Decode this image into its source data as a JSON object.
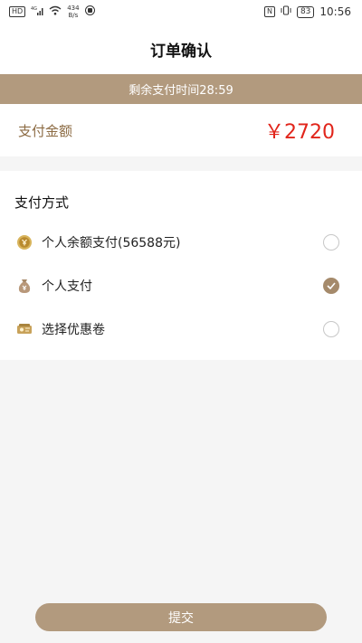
{
  "status_bar": {
    "hd_label": "HD",
    "network_label": "4G",
    "speed_value": "434",
    "speed_unit": "B/s",
    "nfc_label": "N",
    "battery": "83",
    "time": "10:56"
  },
  "header": {
    "title": "订单确认"
  },
  "countdown": {
    "text": "剩余支付时间28:59"
  },
  "amount": {
    "label": "支付金额",
    "value": "￥2720",
    "value_color": "#e1251b"
  },
  "payment": {
    "title": "支付方式",
    "methods": [
      {
        "label": "个人余额支付(56588元)",
        "icon": "coin-icon",
        "selected": false
      },
      {
        "label": "个人支付",
        "icon": "money-bag-icon",
        "selected": true
      },
      {
        "label": "选择优惠卷",
        "icon": "coupon-icon",
        "selected": false
      }
    ]
  },
  "submit": {
    "label": "提交"
  },
  "colors": {
    "accent": "#b29a7e",
    "accent_dark": "#a58a6b",
    "label_brown": "#8c6b43"
  }
}
